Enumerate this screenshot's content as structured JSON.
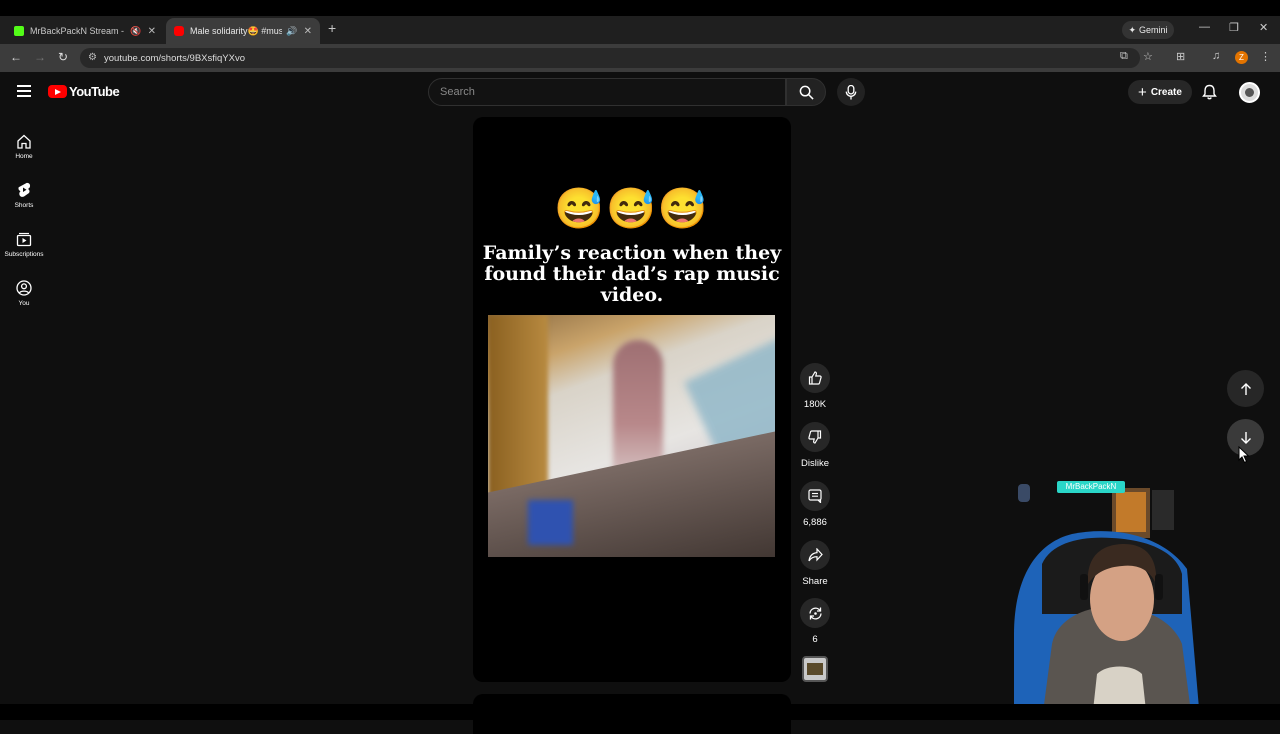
{
  "browser": {
    "tabs": [
      {
        "title": "MrBackPackN Stream - Wa",
        "favicon_color": "#53fc18"
      },
      {
        "title": "Male solidarity🤩 #music #",
        "favicon_color": "#ff0000"
      }
    ],
    "gemini_label": "Gemini",
    "url": "youtube.com/shorts/9BXsfiqYXvo",
    "profile_initial": "Z"
  },
  "youtube": {
    "logo_text": "YouTube",
    "search_placeholder": "Search",
    "create_label": "Create",
    "sidenav": [
      {
        "label": "Home"
      },
      {
        "label": "Shorts"
      },
      {
        "label": "Subscriptions"
      },
      {
        "label": "You"
      }
    ],
    "short": {
      "emojis": "😅😅😅",
      "caption": "Family’s reaction when they found their dad’s rap music video."
    },
    "actions": {
      "likes": "180K",
      "dislike_label": "Dislike",
      "comments": "6,886",
      "share_label": "Share",
      "remix_count": "6"
    }
  },
  "overlay": {
    "streamer_name": "MrBackPackN"
  }
}
